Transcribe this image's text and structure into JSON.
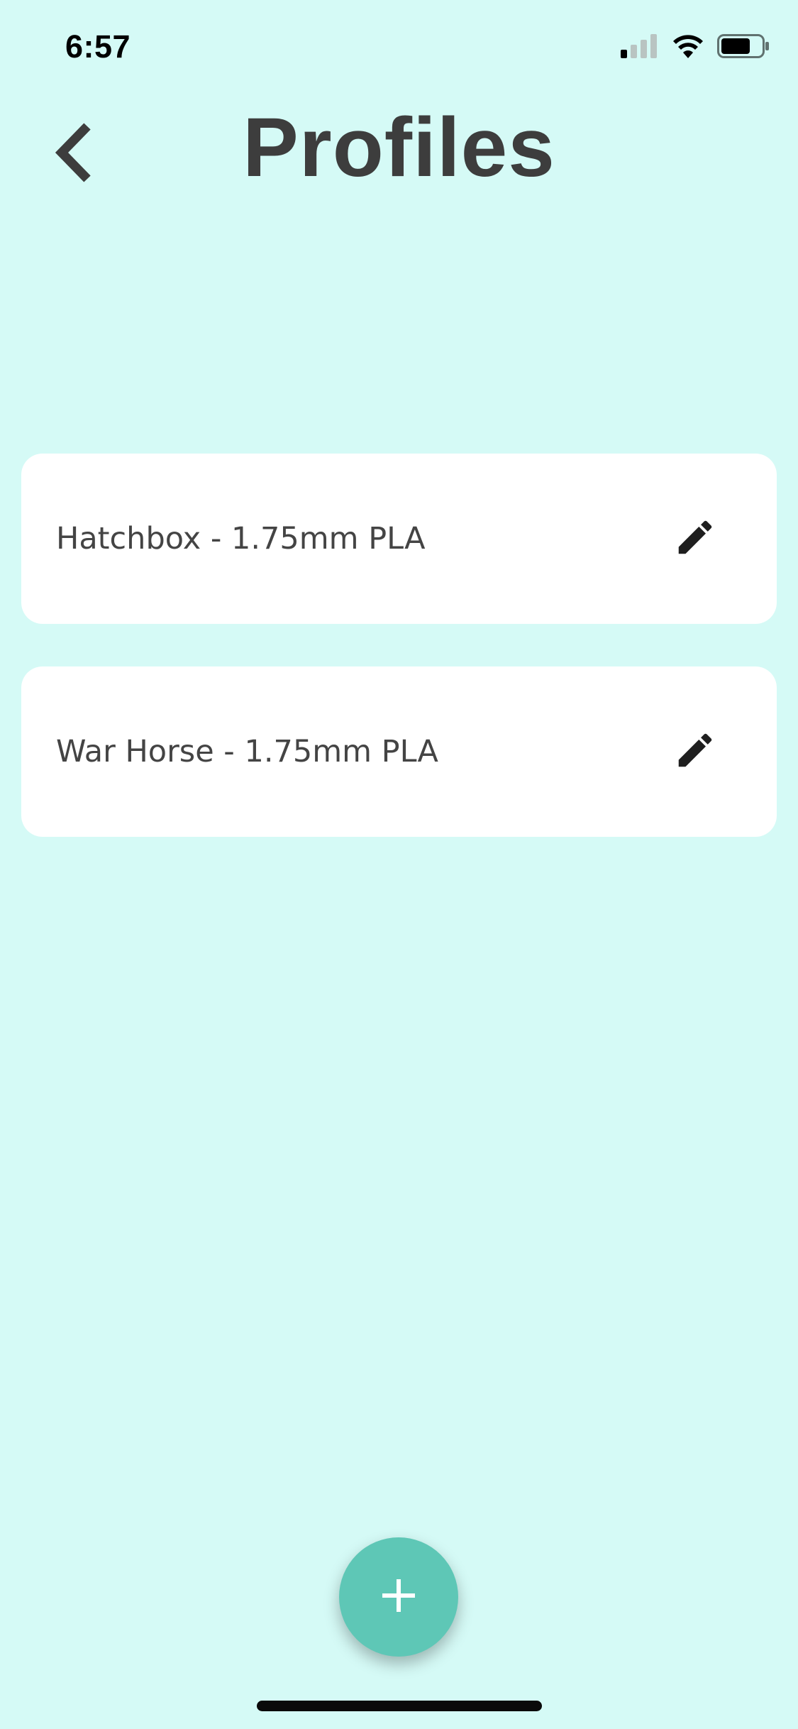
{
  "status_bar": {
    "time": "6:57"
  },
  "header": {
    "title": "Profiles"
  },
  "profiles": [
    {
      "name": "Hatchbox - 1.75mm PLA"
    },
    {
      "name": "War Horse - 1.75mm PLA"
    }
  ],
  "icons": {
    "back": "chevron-left-icon",
    "edit": "pencil-icon",
    "add": "plus-icon"
  },
  "colors": {
    "background": "#d5faf6",
    "card": "#ffffff",
    "accent": "#5ec7b6",
    "title": "#3d3d3d"
  }
}
